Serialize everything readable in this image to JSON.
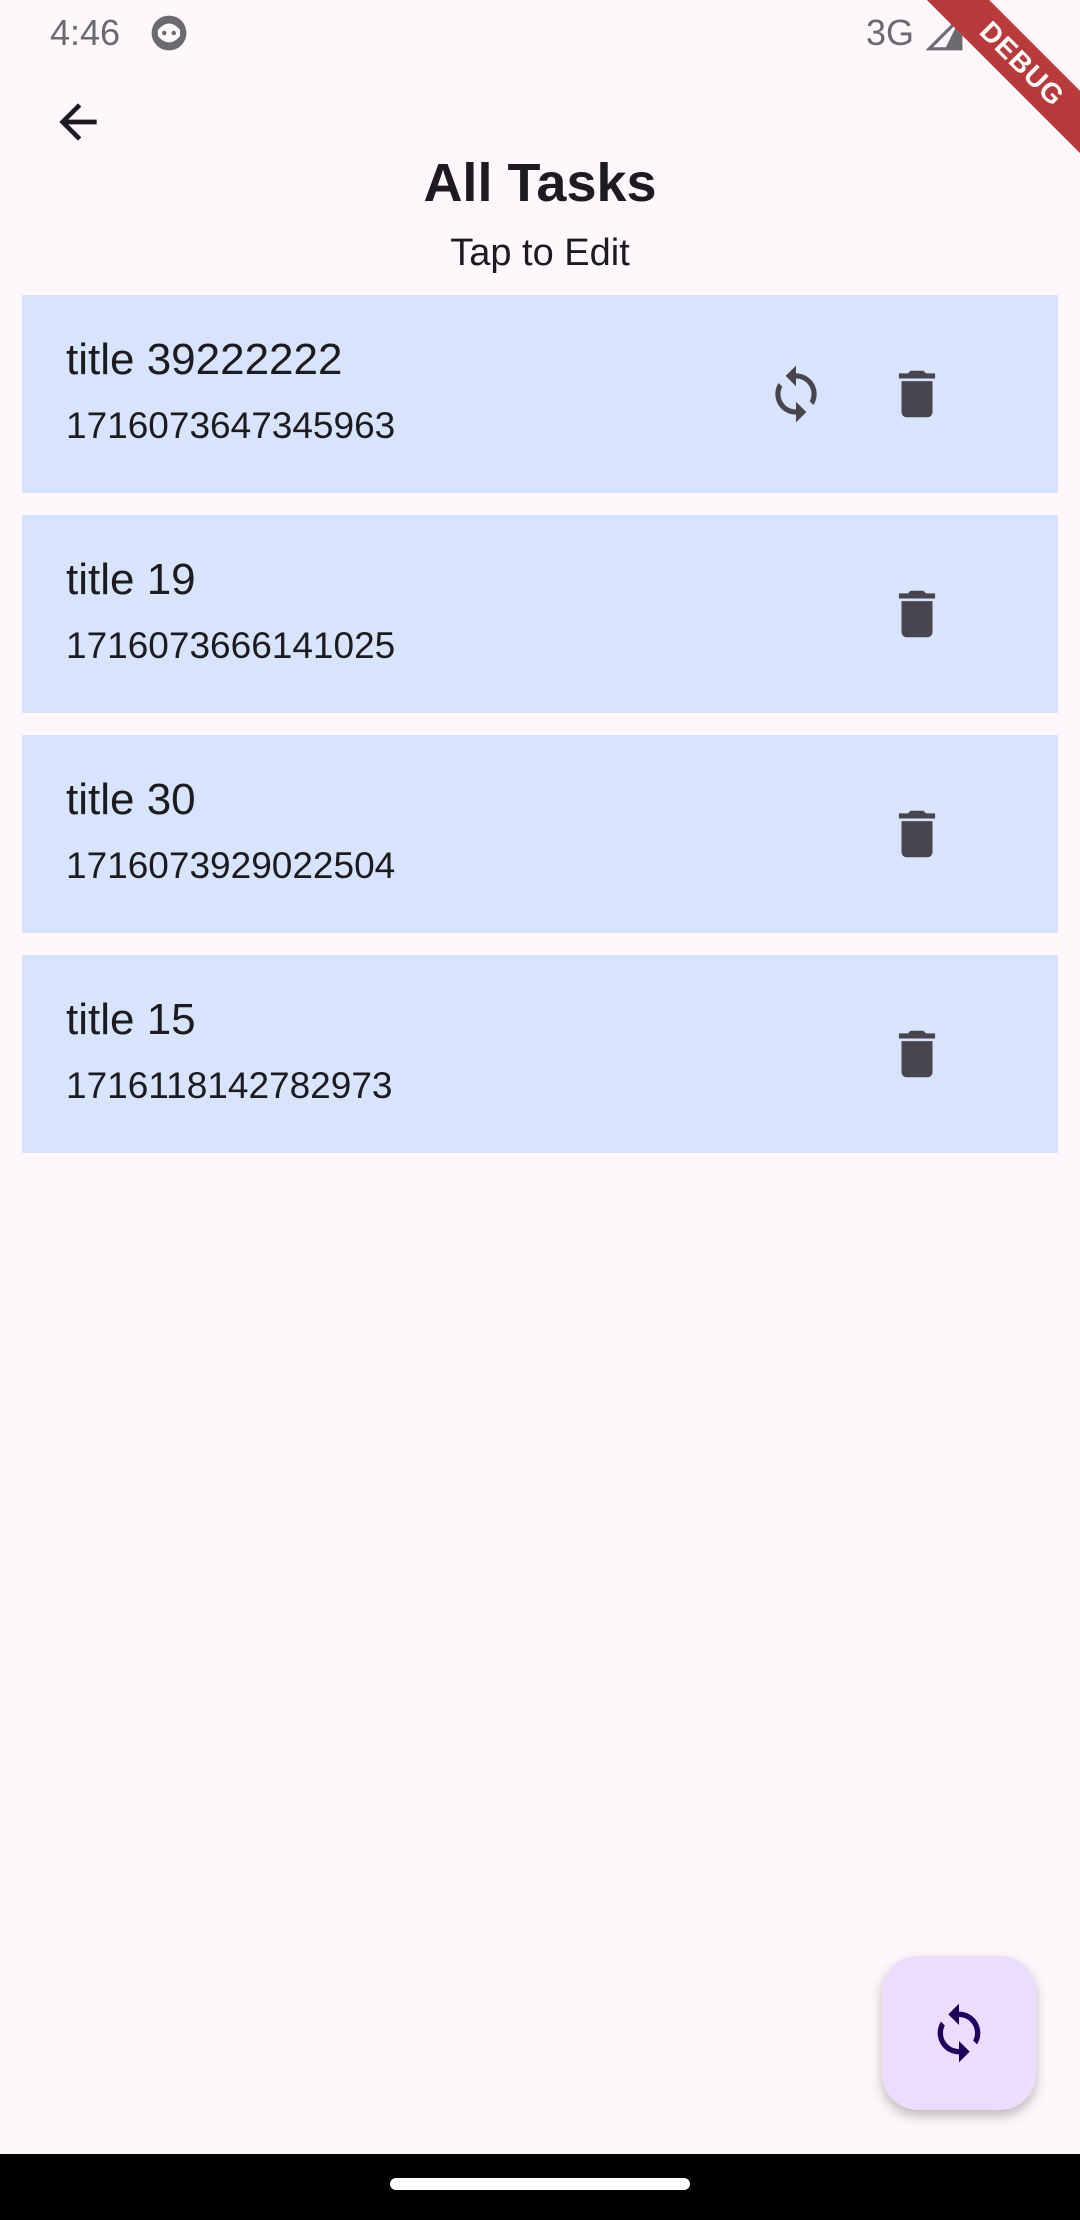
{
  "status_bar": {
    "time": "4:46",
    "network": "3G"
  },
  "debug_banner": {
    "label": "DEBUG",
    "color": "#b83a3a"
  },
  "header": {
    "back_icon": "arrow-left-icon",
    "title": "All Tasks",
    "subtitle": "Tap to Edit"
  },
  "tasks": [
    {
      "title": "title 39222222",
      "id": "1716073647345963",
      "has_sync": true
    },
    {
      "title": "title 19",
      "id": "1716073666141025",
      "has_sync": false
    },
    {
      "title": "title 30",
      "id": "1716073929022504",
      "has_sync": false
    },
    {
      "title": "title 15",
      "id": "1716118142782973",
      "has_sync": false
    }
  ],
  "fab": {
    "icon": "sync-icon"
  },
  "colors": {
    "background": "#fef7fb",
    "card": "#d8e4fc",
    "icon": "#49454f",
    "fab": "#eaddff",
    "fab_icon": "#21005d"
  }
}
